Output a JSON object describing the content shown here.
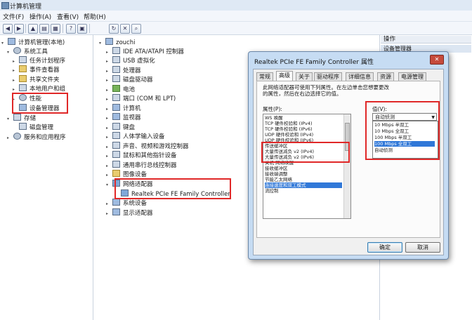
{
  "window": {
    "title": "计算机管理"
  },
  "menu": [
    "文件(F)",
    "操作(A)",
    "查看(V)",
    "帮助(H)"
  ],
  "left_tree": [
    {
      "label": "计算机管理(本地)",
      "expander": "▾"
    },
    {
      "label": "系统工具",
      "expander": "▾"
    },
    {
      "label": "任务计划程序",
      "expander": "▸"
    },
    {
      "label": "事件查看器",
      "expander": "▸"
    },
    {
      "label": "共享文件夹",
      "expander": "▸"
    },
    {
      "label": "本地用户和组",
      "expander": "▸"
    },
    {
      "label": "性能",
      "expander": "▸"
    },
    {
      "label": "设备管理器",
      "expander": ""
    },
    {
      "label": "存储",
      "expander": "▾"
    },
    {
      "label": "磁盘管理",
      "expander": ""
    },
    {
      "label": "服务和应用程序",
      "expander": "▸"
    }
  ],
  "device_tree": {
    "root": "zouchi",
    "items": [
      "IDE ATA/ATAPI 控制器",
      "USB 虚拟化",
      "处理器",
      "磁盘驱动器",
      "电池",
      "端口 (COM 和 LPT)",
      "计算机",
      "监视器",
      "键盘",
      "人体学输入设备",
      "声音、视频和游戏控制器",
      "鼠标和其他指针设备",
      "通用串行总线控制器",
      "图像设备",
      "网络适配器",
      "Realtek PCIe FE Family Controller",
      "系统设备",
      "显示适配器"
    ]
  },
  "actions": {
    "header": "操作",
    "sub": "设备管理器"
  },
  "dialog": {
    "title": "Realtek PCIe FE Family Controller 属性",
    "tabs": [
      "常规",
      "高级",
      "关于",
      "驱动程序",
      "详细信息",
      "资源",
      "电源管理"
    ],
    "description": "此网络适配器可使用下列属性。在左边单击您想要更改的属性，然后在右边选择它的值。",
    "property_label": "属性(P):",
    "properties": [
      "WS 唤醒",
      "TCP 硬件校验和 (IPv4)",
      "TCP 硬件校验和 (IPv6)",
      "UDP 硬件校验和 (IPv4)",
      "UDP 硬件校验和 (IPv6)",
      "传送缓冲区",
      "大量传送减负 v2 (IPv4)",
      "大量传送减负 v2 (IPv6)",
      "关机 网络唤醒",
      "接收缓冲区",
      "接收端调整",
      "节能乙太网络",
      "连接速度和双工模式",
      "流控制"
    ],
    "value_label": "值(V):",
    "value_current": "自动侦测",
    "value_options": [
      "10 Mbps 半双工",
      "10 Mbps 全双工",
      "100 Mbps 半双工",
      "100 Mbps 全双工",
      "自动侦测"
    ],
    "ok": "确定",
    "cancel": "取消"
  }
}
